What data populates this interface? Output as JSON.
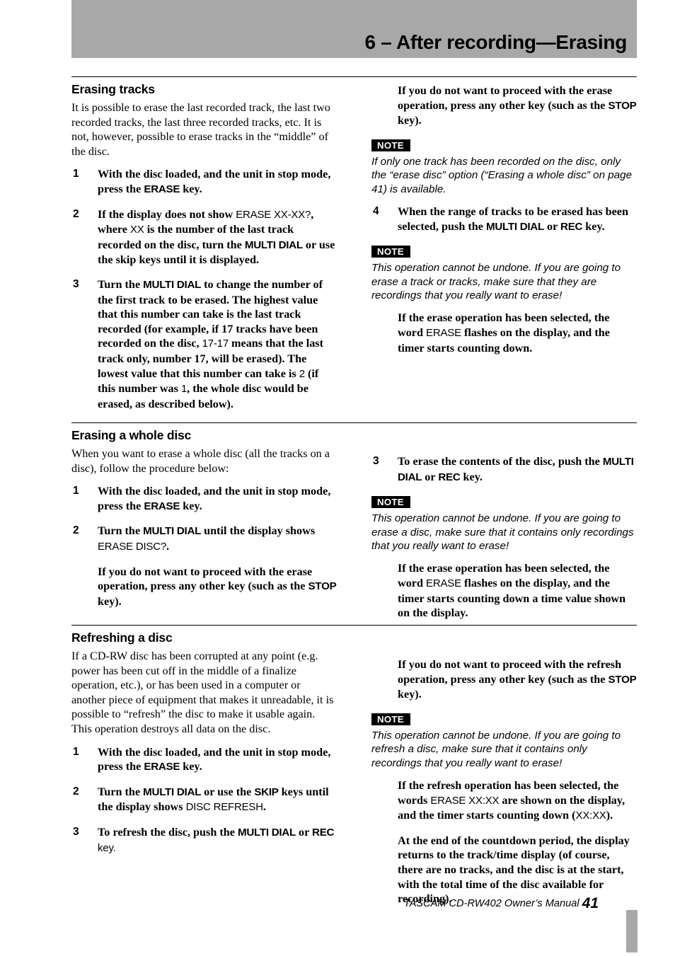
{
  "header": {
    "title": "6 – After recording—Erasing",
    "band_color": "#a8a8a8"
  },
  "sections": [
    {
      "id": "erasing-tracks",
      "title": "Erasing tracks",
      "intro": "It is possible to erase the last recorded track, the last two recorded tracks, the last three recorded tracks, etc. It is not, however, possible to erase tracks in the “middle” of the disc.",
      "steps": {
        "s1_num": "1",
        "s1_a": "With the disc loaded, and the unit in stop mode, press the ",
        "s1_key": "ERASE",
        "s1_b": " key.",
        "s2_num": "2",
        "s2_a": "If the display does not show ",
        "s2_disp1": "ERASE XX-XX?",
        "s2_b": ", where ",
        "s2_disp2": "XX",
        "s2_c": " is the number of the last track recorded on the disc, turn the ",
        "s2_key": "MULTI DIAL",
        "s2_d": " or use the skip keys until it is displayed.",
        "s3_num": "3",
        "s3_a": "Turn the ",
        "s3_key": "MULTI DIAL",
        "s3_b": " to change the number of the first track to be erased. The highest value that this number can take is the last track recorded (for example, if 17 tracks have been recorded on the disc, ",
        "s3_disp1": "17-17",
        "s3_c": " means that the last track only, number 17, will be erased). The lowest value that this number can take is ",
        "s3_disp2": "2",
        "s3_d": " (if this number was ",
        "s3_disp3": "1",
        "s3_e": ", the whole disc would be erased, as described below).",
        "s4_num": "4",
        "s4_a": "When the range of tracks to be erased has been selected, push the ",
        "s4_key1": "MULTI DIAL",
        "s4_b": " or ",
        "s4_key2": "REC",
        "s4_c": " key."
      },
      "right": {
        "abort_a": "If you do not want to proceed with the erase operation, press any other key (such as the ",
        "abort_key": "STOP",
        "abort_b": " key).",
        "note1_badge": "NOTE",
        "note1_text": "If only one track has been recorded on the disc, only the “erase disc” option (“Erasing a whole disc” on page 41) is available.",
        "note2_badge": "NOTE",
        "note2_text": "This operation cannot be undone. If you are going to erase a track or tracks, make sure that they are recordings that you really want to erase!",
        "result_a": "If the erase operation has been selected, the word ",
        "result_disp": "ERASE",
        "result_b": " flashes on the display, and the timer starts counting down."
      }
    },
    {
      "id": "erasing-a-whole-disc",
      "title": "Erasing a whole disc",
      "intro": "When you want to erase a whole disc (all the tracks on a disc), follow the procedure below:",
      "steps": {
        "s1_num": "1",
        "s1_a": "With the disc loaded, and the unit in stop mode, press the ",
        "s1_key": "ERASE",
        "s1_b": " key.",
        "s2_num": "2",
        "s2_a": "Turn the ",
        "s2_key": "MULTI DIAL",
        "s2_b": " until the display shows ",
        "s2_disp": "ERASE DISC?",
        "s2_c": ".",
        "s3_num": "3",
        "s3_a": "To erase the contents of the disc, push the ",
        "s3_key1": "MULTI DIAL",
        "s3_b": " or ",
        "s3_key2": "REC",
        "s3_c": " key."
      },
      "left_abort": {
        "abort_a": "If you do not want to proceed with the erase operation, press any other key (such as the ",
        "abort_key": "STOP",
        "abort_b": " key)."
      },
      "right": {
        "note_badge": "NOTE",
        "note_text": "This operation cannot be undone. If you are going to erase a disc, make sure that it contains only recordings that you really want to erase!",
        "result_a": "If the erase operation has been selected, the word ",
        "result_disp": "ERASE",
        "result_b": " flashes on the display, and the timer starts counting down a time value shown on the display."
      }
    },
    {
      "id": "refreshing-a-disc",
      "title": "Refreshing a disc",
      "intro": "If a CD-RW disc has been corrupted at any point (e.g. power has been cut off in the middle of a finalize operation, etc.), or has been used in a computer or another piece of equipment that makes it unreadable, it is possible to “refresh” the disc to make it usable again. This operation destroys all data on the disc.",
      "steps": {
        "s1_num": "1",
        "s1_a": "With the disc loaded, and the unit in stop mode, press the ",
        "s1_key": "ERASE",
        "s1_b": " key.",
        "s2_num": "2",
        "s2_a": "Turn the ",
        "s2_key1": "MULTI DIAL",
        "s2_b": " or use the  ",
        "s2_key2": "SKIP",
        "s2_c": " keys until the display shows ",
        "s2_disp": "DISC REFRESH",
        "s2_d": ".",
        "s3_num": "3",
        "s3_a": "To refresh the disc, push the ",
        "s3_key1": "MULTI DIAL",
        "s3_b": " or ",
        "s3_key2": "REC",
        "s3_disp": " key."
      },
      "right": {
        "abort_a": "If you do not want to proceed with the refresh operation, press any other key (such as the ",
        "abort_key": "STOP",
        "abort_b": " key).",
        "note_badge": "NOTE",
        "note_text": "This operation cannot be undone. If you are going to refresh a disc, make sure that it contains only recordings that you really want to erase!",
        "result1_a": "If the refresh operation has been selected, the words ",
        "result1_disp1": "ERASE XX:XX",
        "result1_b": " are shown on the display, and the timer starts counting down (",
        "result1_disp2": "XX:XX",
        "result1_c": ").",
        "result2": "At the end of the countdown period, the display returns to the track/time display (of course, there are no tracks, and the disc is at the start, with the total time of the disc available for recording)."
      }
    }
  ],
  "footer": {
    "manual": "TASCAM CD-RW402 Owner’s Manual",
    "page_number": "41"
  }
}
